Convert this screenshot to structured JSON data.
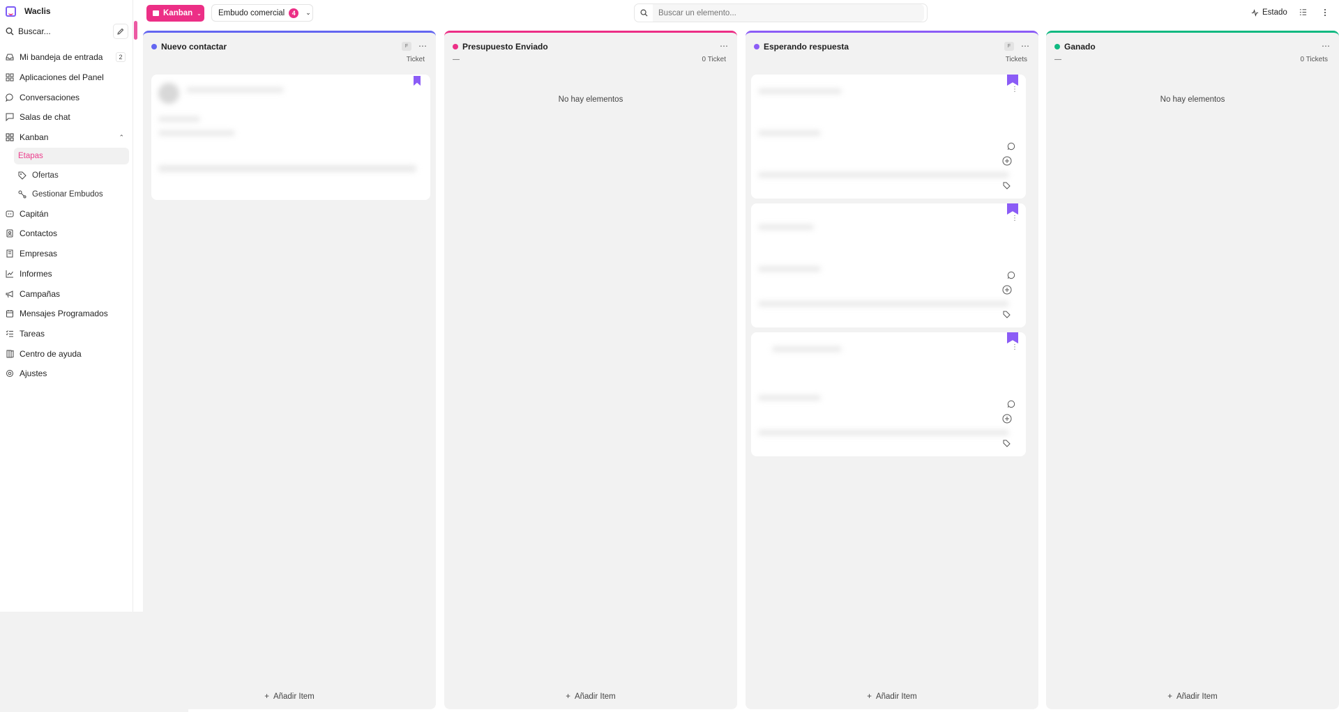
{
  "app": {
    "name": "Waclis"
  },
  "sidebar": {
    "search_label": "Buscar...",
    "items": [
      {
        "label": "Mi bandeja de entrada",
        "badge": "2",
        "icon": "inbox-icon"
      },
      {
        "label": "Aplicaciones del Panel",
        "icon": "apps-icon"
      },
      {
        "label": "Conversaciones",
        "icon": "chat-bubble-icon"
      },
      {
        "label": "Salas de chat",
        "icon": "chat-room-icon"
      },
      {
        "label": "Kanban",
        "icon": "kanban-icon",
        "expanded": true
      },
      {
        "label": "Capitán",
        "icon": "captain-icon"
      },
      {
        "label": "Contactos",
        "icon": "contacts-icon"
      },
      {
        "label": "Empresas",
        "icon": "building-icon"
      },
      {
        "label": "Informes",
        "icon": "chart-icon"
      },
      {
        "label": "Campañas",
        "icon": "megaphone-icon"
      },
      {
        "label": "Mensajes Programados",
        "icon": "calendar-icon"
      },
      {
        "label": "Tareas",
        "icon": "tasks-icon"
      },
      {
        "label": "Centro de ayuda",
        "icon": "book-icon"
      },
      {
        "label": "Ajustes",
        "icon": "settings-icon"
      }
    ],
    "kanban_sub": [
      {
        "label": "Etapas",
        "active": true
      },
      {
        "label": "Ofertas",
        "icon": "tag-icon"
      },
      {
        "label": "Gestionar Embudos",
        "icon": "funnel-icon"
      }
    ]
  },
  "toolbar": {
    "view_label": "Kanban",
    "pipeline_label": "Embudo comercial",
    "pipeline_count": "4",
    "search_placeholder": "Buscar un elemento...",
    "status_label": "Estado"
  },
  "columns": [
    {
      "title": "Nuevo contactar",
      "color": "#6366f1",
      "sub_left": "",
      "sub_right": "Ticket",
      "empty": "",
      "add_label": "Añadir Item"
    },
    {
      "title": "Presupuesto Enviado",
      "color": "#ec2f86",
      "sub_left": "—",
      "sub_right": "0 Ticket",
      "empty": "No hay elementos",
      "add_label": "Añadir Item"
    },
    {
      "title": "Esperando respuesta",
      "color": "#8b5cf6",
      "sub_left": "",
      "sub_right": "Tickets",
      "empty": "",
      "add_label": "Añadir Item"
    },
    {
      "title": "Ganado",
      "color": "#10b981",
      "sub_left": "—",
      "sub_right": "0 Tickets",
      "empty": "No hay elementos",
      "add_label": "Añadir Item"
    }
  ],
  "f_tag": "F",
  "bookmark_mark": "0"
}
